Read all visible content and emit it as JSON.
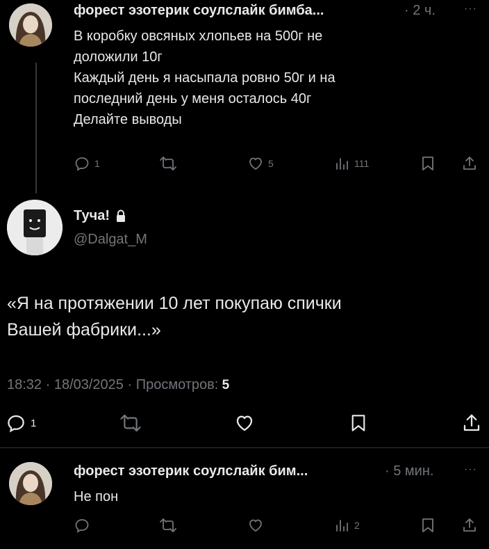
{
  "post1": {
    "author": "форест эзотерик соулслайк бимба...",
    "time": "· 2 ч.",
    "more": "···",
    "lines": [
      "В коробку овсяных хлопьев на 500г не",
      "доложили 10г",
      "Каждый день я насыпала ровно 50г и на",
      "последний день у меня осталось 40г",
      "Делайте выводы"
    ],
    "replies": "1",
    "likes": "5",
    "views": "111"
  },
  "post2": {
    "author": "Туча!",
    "handle": "@Dalgat_M",
    "lines": [
      "«Я на протяжении 10 лет покупаю спички",
      "Вашей фабрики...»"
    ],
    "timestamp": "18:32 · 18/03/2025 · Просмотров:",
    "views": "5",
    "replies": "1"
  },
  "post3": {
    "author": "форест эзотерик соулслайк бим...",
    "time": "· 5 мин.",
    "more": "···",
    "text": "Не пон",
    "views": "2"
  }
}
